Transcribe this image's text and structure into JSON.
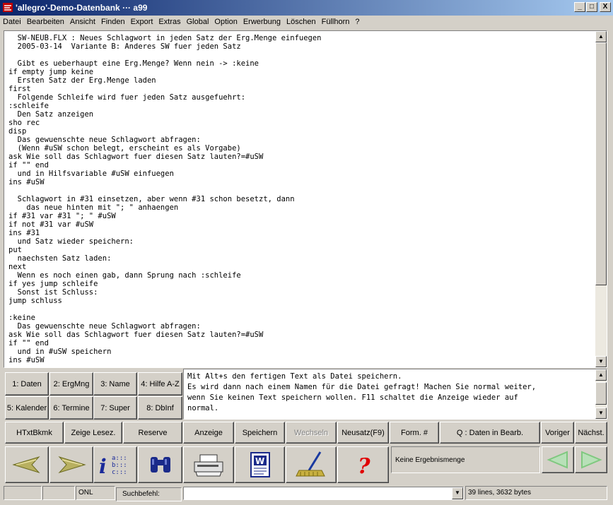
{
  "window": {
    "title": "'allegro'-Demo-Datenbank ··· a99",
    "min_label": "_",
    "max_label": "□",
    "close_label": "X"
  },
  "menu": [
    "Datei",
    "Bearbeiten",
    "Ansicht",
    "Finden",
    "Export",
    "Extras",
    "Global",
    "Option",
    "Erwerbung",
    "Löschen",
    "Füllhorn",
    "?"
  ],
  "editor": {
    "text": "  SW-NEUB.FLX : Neues Schlagwort in jeden Satz der Erg.Menge einfuegen\n  2005-03-14  Variante B: Anderes SW fuer jeden Satz\n\n  Gibt es ueberhaupt eine Erg.Menge? Wenn nein -> :keine\nif empty jump keine\n  Ersten Satz der Erg.Menge laden\nfirst\n  Folgende Schleife wird fuer jeden Satz ausgefuehrt:\n:schleife\n  Den Satz anzeigen\nsho rec\ndisp\n  Das gewuenschte neue Schlagwort abfragen:\n  (Wenn #uSW schon belegt, erscheint es als Vorgabe)\nask Wie soll das Schlagwort fuer diesen Satz lauten?=#uSW\nif \"\" end\n  und in Hilfsvariable #uSW einfuegen\nins #uSW\n\n  Schlagwort in #31 einsetzen, aber wenn #31 schon besetzt, dann\n    das neue hinten mit \"; \" anhaengen\nif #31 var #31 \"; \" #uSW\nif not #31 var #uSW\nins #31\n  und Satz wieder speichern:\nput\n  naechsten Satz laden:\nnext\n  Wenn es noch einen gab, dann Sprung nach :schleife\nif yes jump schleife\n  Sonst ist Schluss:\njump schluss\n\n:keine\n  Das gewuenschte neue Schlagwort abfragen:\nask Wie soll das Schlagwort fuer diesen Satz lauten?=#uSW\nif \"\" end\n  und in #uSW speichern\nins #uSW"
  },
  "message": "Mit Alt+s den fertigen Text als Datei speichern.\nEs wird dann nach einem Namen für die Datei gefragt! Machen Sie normal weiter,\nwenn Sie keinen Text speichern wollen. F11 schaltet die Anzeige wieder auf\nnormal.",
  "index_buttons": [
    "1: Daten",
    "2: ErgMng",
    "3: Name",
    "4: Hilfe A-Z",
    "5: Kalender",
    "6: Termine",
    "7: Super",
    "8: DbInf"
  ],
  "row_buttons": {
    "htxtbkmk": "HTxtBkmk",
    "zeige_lesez": "Zeige Lesez.",
    "reserve": "Reserve",
    "anzeige": "Anzeige",
    "speichern": "Speichern",
    "wechseln": "Wechseln",
    "neusatz": "Neusatz(F9)",
    "form": "Form. #",
    "daten_bearb": "Q : Daten in Bearb.",
    "voriger": "Voriger",
    "naechst": "Nächst."
  },
  "result_status": "Keine Ergebnismenge",
  "statusbar": {
    "mode": "ONL",
    "search_label": "Suchbefehl:",
    "search_value": "",
    "info": "39 lines, 3632 bytes"
  },
  "colors": {
    "title_start": "#0a246a",
    "title_end": "#a6caf0",
    "face": "#d4d0c8",
    "arrow_green": "#7fc87f",
    "help_red": "#e00000"
  }
}
